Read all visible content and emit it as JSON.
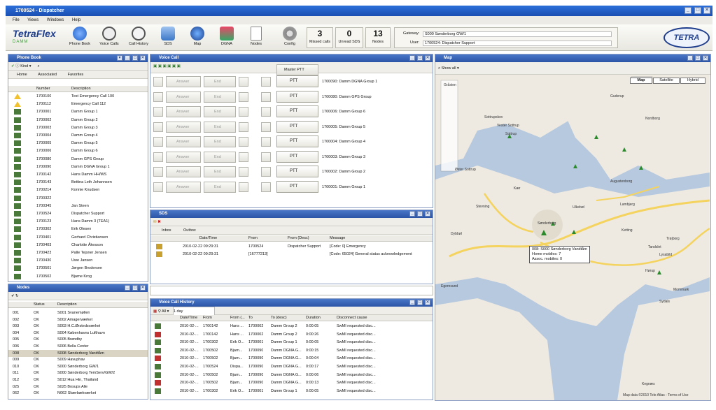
{
  "window": {
    "title": "1700524 - Dispatcher",
    "min": "_",
    "max": "□",
    "close": "✕"
  },
  "menu": [
    "File",
    "Views",
    "Windows",
    "Help"
  ],
  "toolbar": {
    "logo": "TetraFlex",
    "logo_sub": "DAMM",
    "buttons": [
      "Phone Book",
      "Voice Calls",
      "Call History",
      "SDS",
      "Map",
      "DGNA",
      "Nodes",
      "Config"
    ],
    "counters": [
      {
        "n": "3",
        "l": "Missed calls"
      },
      {
        "n": "0",
        "l": "Unread SDS"
      },
      {
        "n": "13",
        "l": "Nodes"
      }
    ],
    "gateway_label": "Gateway:",
    "gateway_value": "S000 Sønderborg GW/1",
    "user_label": "User:",
    "user_value": "1700524: Dispatcher Support",
    "tetra": "TETRA"
  },
  "phonebook": {
    "title": "Phone Book",
    "kind": "Kind",
    "tabs": [
      "Home",
      "Associated",
      "Favorites"
    ],
    "cols": [
      "Number",
      "Description"
    ],
    "rows": [
      [
        "1700100",
        "Test Emergency Call 100"
      ],
      [
        "1700112",
        "Emergency Call 112"
      ],
      [
        "1700001",
        "Damm Group 1"
      ],
      [
        "1700002",
        "Damm Group 2"
      ],
      [
        "1700003",
        "Damm Group 3"
      ],
      [
        "1700004",
        "Damm Group 4"
      ],
      [
        "1700005",
        "Damm Group 5"
      ],
      [
        "1700006",
        "Damm Group 6"
      ],
      [
        "1700080",
        "Damm GPS Group"
      ],
      [
        "1700090",
        "Damm DGNA Group 1"
      ],
      [
        "1700142",
        "Hans Damm HH/WS"
      ],
      [
        "1700143",
        "Bettina Leth Johannsen"
      ],
      [
        "1700214",
        "Konnie Knudsen"
      ],
      [
        "1700322",
        ""
      ],
      [
        "1700345",
        "Jan Steen"
      ],
      [
        "1700524",
        "Dispatcher Support"
      ],
      [
        "1700123",
        "Hans Damm 3 (TEA1)"
      ],
      [
        "1700302",
        "Erik Olesen"
      ],
      [
        "1700401",
        "Gerhard Christiansen"
      ],
      [
        "1700403",
        "Charlotte Åkesson"
      ],
      [
        "1700423",
        "Palle Tejsner Jensen"
      ],
      [
        "1700430",
        "Uwe Jansen"
      ],
      [
        "1700501",
        "Jørgen Brodersen"
      ],
      [
        "1700502",
        "Bjarne Krog"
      ]
    ]
  },
  "nodes": {
    "title": "Nodes",
    "cols": [
      "Status",
      "Description"
    ],
    "rows": [
      [
        "001",
        "OK",
        "S001 Svanemøllen"
      ],
      [
        "002",
        "OK",
        "S002 Amagerværket"
      ],
      [
        "003",
        "OK",
        "S003 H.C.Ørstedsværket"
      ],
      [
        "004",
        "OK",
        "S004 Københavns Lufthavn"
      ],
      [
        "005",
        "OK",
        "S005 Brøndby"
      ],
      [
        "006",
        "OK",
        "S006 Bella Center"
      ],
      [
        "008",
        "OK",
        "S008 Sønderborg Vandtårn"
      ],
      [
        "009",
        "OK",
        "S009 Havuphav"
      ],
      [
        "010",
        "OK",
        "S000 Sønderborg GW/1"
      ],
      [
        "011",
        "OK",
        "S000 Sønderborg TemServ/GW/2"
      ],
      [
        "012",
        "OK",
        "S012 Hua Hin, Thailand"
      ],
      [
        "025",
        "OK",
        "S025 Bosups Alle"
      ],
      [
        "062",
        "OK",
        "N062 Skærbækværket"
      ]
    ]
  },
  "voicecall": {
    "title": "Voice Call",
    "master": "Master PTT",
    "answer": "Answer",
    "end": "End",
    "ptt": "PTT",
    "groups": [
      "1700090: Damm DGNA Group 1",
      "1700080: Damm GPS Group",
      "1700006: Damm Group 6",
      "1700005: Damm Group 5",
      "1700004: Damm Group 4",
      "1700003: Damm Group 3",
      "1700002: Damm Group 2",
      "1700001: Damm Group 1"
    ]
  },
  "sds": {
    "title": "SDS",
    "tabs": [
      "Inbox",
      "Outbox"
    ],
    "cols": [
      "Date/Time",
      "From",
      "From (Desc)",
      "Message"
    ],
    "rows": [
      [
        "2010-02-22 09:29:31",
        "1700524",
        "Dispatcher Support",
        "[Code: 0] Emergency"
      ],
      [
        "2010-02-22 09:29:31",
        "[16777213]",
        "",
        "[Code: 65024] General status acknowledgement"
      ]
    ]
  },
  "history": {
    "title": "Voice Call History",
    "filter": "All",
    "period": "1 day",
    "cols": [
      "Date/Time",
      "From",
      "From (...",
      "To",
      "To (desc)",
      "Duration",
      "Disconnect cause"
    ],
    "rows": [
      [
        "2010-02-...",
        "1700142",
        "Hans ...",
        "1700002",
        "Damm Group 2",
        "0:00:05",
        "SwMI requested disc..."
      ],
      [
        "2010-02-...",
        "1700142",
        "Hans ...",
        "1700002",
        "Damm Group 2",
        "0:00:26",
        "SwMI requested disc..."
      ],
      [
        "2010-02-...",
        "1700302",
        "Erik O...",
        "1700001",
        "Damm Group 1",
        "0:00:05",
        "SwMI requested disc..."
      ],
      [
        "2010-02-...",
        "1700502",
        "Bjarn...",
        "1700090",
        "Damm DGNA G...",
        "0:00:15",
        "SwMI requested disc..."
      ],
      [
        "2010-02-...",
        "1700502",
        "Bjarn...",
        "1700090",
        "Damm DGNA G...",
        "0:00:04",
        "SwMI requested disc..."
      ],
      [
        "2010-02-...",
        "1700524",
        "Dispa...",
        "1700090",
        "Damm DGNA G...",
        "0:00:17",
        "SwMI requested disc..."
      ],
      [
        "2010-02-...",
        "1700502",
        "Bjarn...",
        "1700090",
        "Damm DGNA G...",
        "0:00:06",
        "SwMI requested disc..."
      ],
      [
        "2010-02-...",
        "1700502",
        "Bjarn...",
        "1700090",
        "Damm DGNA G...",
        "0:00:13",
        "SwMI requested disc..."
      ],
      [
        "2010-02-...",
        "1700302",
        "Erik O...",
        "1700001",
        "Damm Group 1",
        "0:00:05",
        "SwMI requested disc..."
      ]
    ]
  },
  "map": {
    "title": "Map",
    "showall": "Show all",
    "types": [
      "Map",
      "Satellite",
      "Hybrid"
    ],
    "tooltip": [
      "008: S000 Sønderborg Vandtårn",
      "Home mobiles: 7",
      "Assoc. mobiles: 0"
    ],
    "labels": [
      "Sottrupskov",
      "Sottrup",
      "Øster Sottrup",
      "Kær",
      "Ulkebøl",
      "Augustenborg",
      "Lambjerg",
      "Dybbøl",
      "Sønderborg",
      "Egernsund",
      "Trøjborg",
      "Vester Sottrup",
      "Stevning",
      "Ketting",
      "Guderup",
      "Lysabild",
      "Hørup",
      "Mommark",
      "Sydals",
      "Tandslet",
      "Kegnæs",
      "Gråsten",
      "Nordborg"
    ],
    "copyright": "Map data ©2010 Tele Atlas - Terms of Use"
  },
  "colors": {
    "title": "#1a4fb2",
    "pane_header": "#2b54a5",
    "water": "#b7c9de",
    "land": "#eeeae2"
  }
}
